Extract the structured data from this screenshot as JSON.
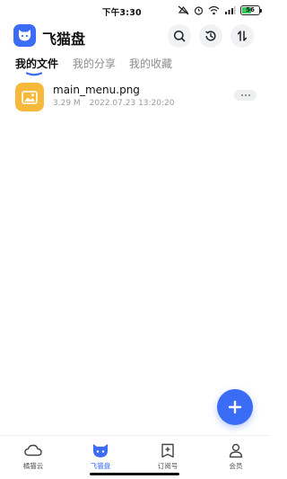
{
  "status_bar": {
    "time": "下午3:30",
    "battery_level": "56",
    "battery_color": "#35c759",
    "icons": [
      "mute-icon",
      "alarm-icon",
      "wifi-icon",
      "signal-icon",
      "battery-icon"
    ]
  },
  "header": {
    "title": "飞猫盘",
    "logo_icon": "cat-logo-icon",
    "actions": [
      "search-icon",
      "history-icon",
      "sort-icon"
    ]
  },
  "tabs": [
    {
      "label": "我的文件",
      "active": true
    },
    {
      "label": "我的分享",
      "active": false
    },
    {
      "label": "我的收藏",
      "active": false
    }
  ],
  "files": [
    {
      "name": "main_menu.png",
      "size": "3.29 M",
      "modified": "2022.07.23 13:20:20",
      "icon": "image-file-icon"
    }
  ],
  "fab": {
    "icon": "plus-icon"
  },
  "bottom_nav": [
    {
      "label": "橘猫云",
      "icon": "cloud-icon",
      "active": false
    },
    {
      "label": "飞猫盘",
      "icon": "cat-icon",
      "active": true
    },
    {
      "label": "订阅号",
      "icon": "subscribe-icon",
      "active": false
    },
    {
      "label": "会员",
      "icon": "member-icon",
      "active": false
    }
  ],
  "colors": {
    "accent": "#3b6cf6",
    "file_icon_bg": "#f6b93b",
    "inactive_text": "#8c8c8c"
  }
}
